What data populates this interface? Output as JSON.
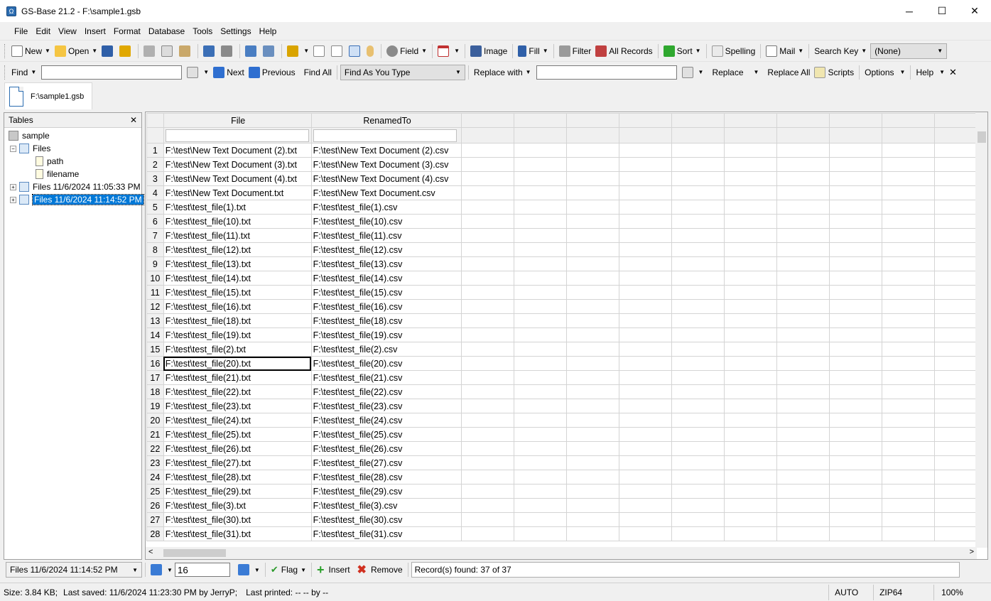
{
  "window": {
    "title": "GS-Base 21.2 - F:\\sample1.gsb",
    "minimize": "─",
    "maximize": "☐",
    "close": "✕"
  },
  "menu": [
    "File",
    "Edit",
    "View",
    "Insert",
    "Format",
    "Database",
    "Tools",
    "Settings",
    "Help"
  ],
  "toolbar1": {
    "new": "New",
    "open": "Open",
    "field": "Field",
    "image": "Image",
    "fill": "Fill",
    "filter": "Filter",
    "all_records": "All Records",
    "sort": "Sort",
    "spelling": "Spelling",
    "mail": "Mail",
    "search_key": "Search Key",
    "search_key_value": "(None)"
  },
  "toolbar2": {
    "find": "Find",
    "find_value": "",
    "next": "Next",
    "previous": "Previous",
    "find_all": "Find All",
    "find_mode": "Find As You Type",
    "replace_with": "Replace with",
    "replace_value": "",
    "replace": "Replace",
    "replace_all": "Replace All",
    "scripts": "Scripts",
    "options": "Options",
    "help": "Help"
  },
  "doc_tab": "F:\\sample1.gsb",
  "sidebar": {
    "title": "Tables",
    "tree": {
      "root": "sample",
      "files": "Files",
      "fields": [
        "path",
        "filename"
      ],
      "snapshot1": "Files 11/6/2024 11:05:33 PM",
      "snapshot2": "Files 11/6/2024 11:14:52 PM"
    }
  },
  "grid": {
    "columns": [
      "File",
      "RenamedTo"
    ],
    "rows": [
      [
        "F:\\test\\New Text Document (2).txt",
        "F:\\test\\New Text Document (2).csv"
      ],
      [
        "F:\\test\\New Text Document (3).txt",
        "F:\\test\\New Text Document (3).csv"
      ],
      [
        "F:\\test\\New Text Document (4).txt",
        "F:\\test\\New Text Document (4).csv"
      ],
      [
        "F:\\test\\New Text Document.txt",
        "F:\\test\\New Text Document.csv"
      ],
      [
        "F:\\test\\test_file(1).txt",
        "F:\\test\\test_file(1).csv"
      ],
      [
        "F:\\test\\test_file(10).txt",
        "F:\\test\\test_file(10).csv"
      ],
      [
        "F:\\test\\test_file(11).txt",
        "F:\\test\\test_file(11).csv"
      ],
      [
        "F:\\test\\test_file(12).txt",
        "F:\\test\\test_file(12).csv"
      ],
      [
        "F:\\test\\test_file(13).txt",
        "F:\\test\\test_file(13).csv"
      ],
      [
        "F:\\test\\test_file(14).txt",
        "F:\\test\\test_file(14).csv"
      ],
      [
        "F:\\test\\test_file(15).txt",
        "F:\\test\\test_file(15).csv"
      ],
      [
        "F:\\test\\test_file(16).txt",
        "F:\\test\\test_file(16).csv"
      ],
      [
        "F:\\test\\test_file(18).txt",
        "F:\\test\\test_file(18).csv"
      ],
      [
        "F:\\test\\test_file(19).txt",
        "F:\\test\\test_file(19).csv"
      ],
      [
        "F:\\test\\test_file(2).txt",
        "F:\\test\\test_file(2).csv"
      ],
      [
        "F:\\test\\test_file(20).txt",
        "F:\\test\\test_file(20).csv"
      ],
      [
        "F:\\test\\test_file(21).txt",
        "F:\\test\\test_file(21).csv"
      ],
      [
        "F:\\test\\test_file(22).txt",
        "F:\\test\\test_file(22).csv"
      ],
      [
        "F:\\test\\test_file(23).txt",
        "F:\\test\\test_file(23).csv"
      ],
      [
        "F:\\test\\test_file(24).txt",
        "F:\\test\\test_file(24).csv"
      ],
      [
        "F:\\test\\test_file(25).txt",
        "F:\\test\\test_file(25).csv"
      ],
      [
        "F:\\test\\test_file(26).txt",
        "F:\\test\\test_file(26).csv"
      ],
      [
        "F:\\test\\test_file(27).txt",
        "F:\\test\\test_file(27).csv"
      ],
      [
        "F:\\test\\test_file(28).txt",
        "F:\\test\\test_file(28).csv"
      ],
      [
        "F:\\test\\test_file(29).txt",
        "F:\\test\\test_file(29).csv"
      ],
      [
        "F:\\test\\test_file(3).txt",
        "F:\\test\\test_file(3).csv"
      ],
      [
        "F:\\test\\test_file(30).txt",
        "F:\\test\\test_file(30).csv"
      ],
      [
        "F:\\test\\test_file(31).txt",
        "F:\\test\\test_file(31).csv"
      ]
    ],
    "active_row": 16
  },
  "navbar": {
    "table_select": "Files 11/6/2024 11:14:52 PM",
    "record": "16",
    "flag": "Flag",
    "insert": "Insert",
    "remove": "Remove",
    "records_found": "Record(s) found: 37 of 37"
  },
  "status": {
    "size": "Size: 3.84 KB;",
    "last_saved": "Last saved: 11/6/2024 11:23:30 PM by JerryP;",
    "last_printed": "Last printed: -- -- by --",
    "mode": "AUTO",
    "compression": "ZIP64",
    "zoom": "100%"
  }
}
